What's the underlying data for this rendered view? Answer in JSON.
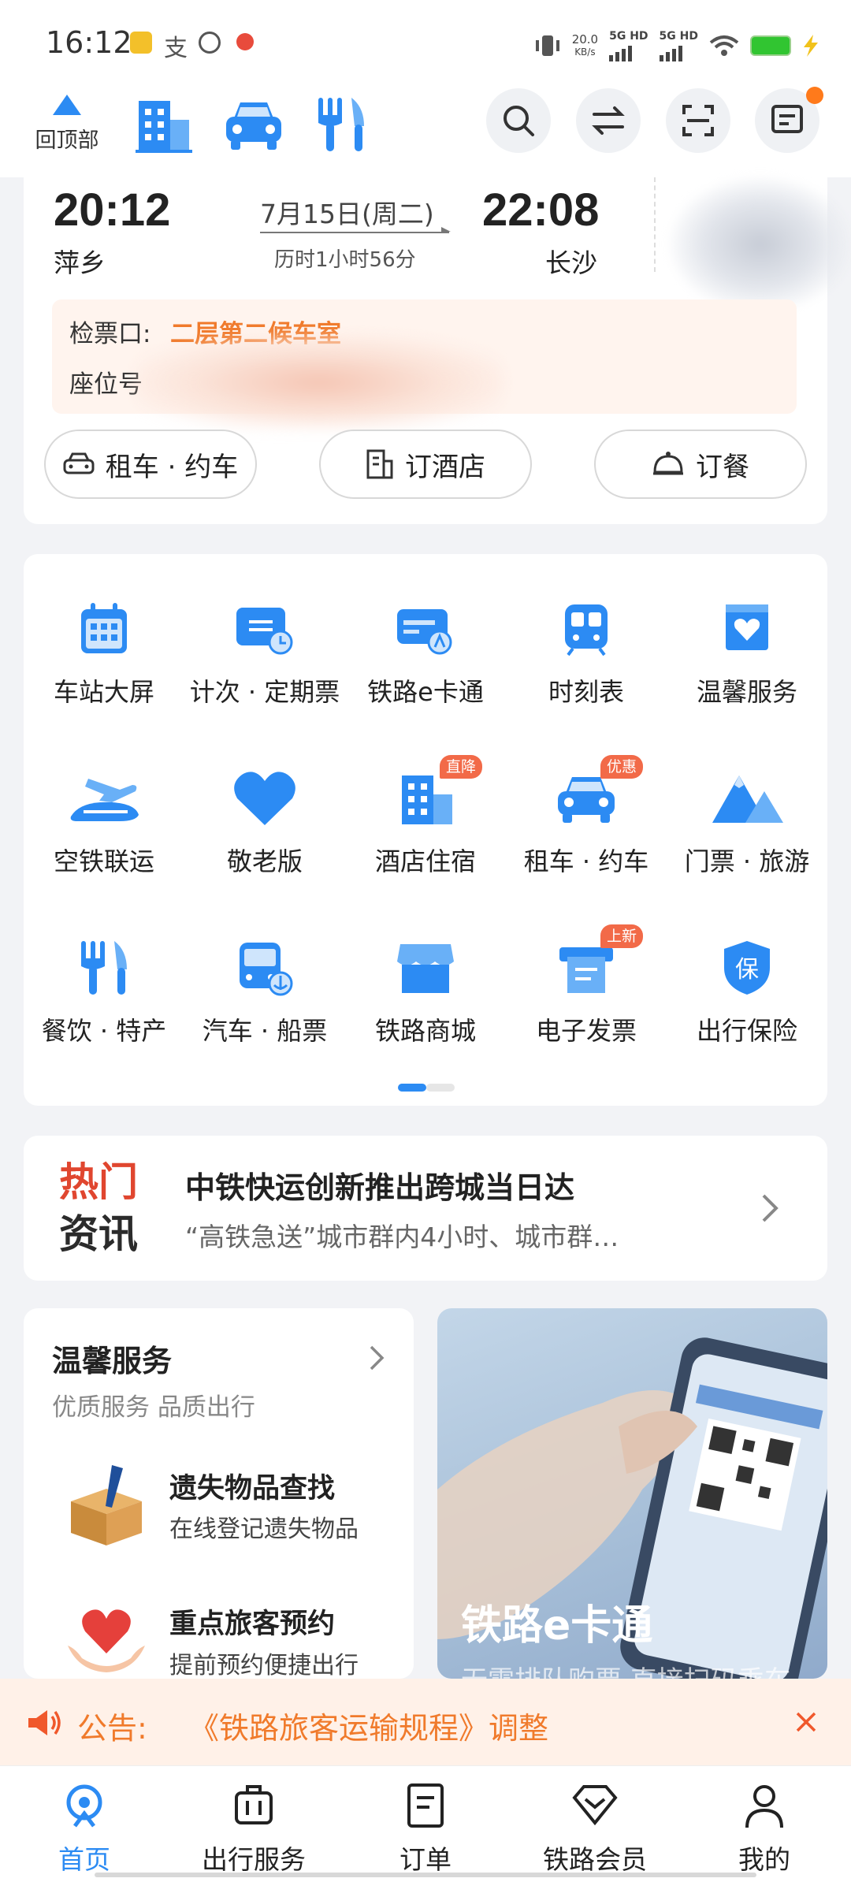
{
  "status_bar": {
    "time": "16:12",
    "speed_top": "20.0",
    "speed_unit": "KB/s",
    "net1": "5G HD",
    "net2": "5G HD"
  },
  "top_nav": {
    "back_top_label": "回顶部"
  },
  "trip": {
    "depart_time": "20:12",
    "depart_station": "萍乡",
    "date": "7月15日(周二)",
    "duration": "历时1小时56分",
    "arrive_time": "22:08",
    "arrive_station": "长沙",
    "gate_label": "检票口:",
    "gate_value": "二层第二候车室",
    "seat_label": "座位号",
    "actions": [
      "租车 · 约车",
      "订酒店",
      "订餐"
    ]
  },
  "grid": {
    "items": [
      {
        "label": "车站大屏",
        "icon": "calendar-icon",
        "badge": ""
      },
      {
        "label": "计次 · 定期票",
        "icon": "ticket-clock-icon",
        "badge": ""
      },
      {
        "label": "铁路e卡通",
        "icon": "rail-card-icon",
        "badge": ""
      },
      {
        "label": "时刻表",
        "icon": "train-icon",
        "badge": ""
      },
      {
        "label": "温馨服务",
        "icon": "heart-box-icon",
        "badge": ""
      },
      {
        "label": "空铁联运",
        "icon": "plane-train-icon",
        "badge": ""
      },
      {
        "label": "敬老版",
        "icon": "heart-icon",
        "badge": ""
      },
      {
        "label": "酒店住宿",
        "icon": "hotel-icon",
        "badge": "直降"
      },
      {
        "label": "租车 · 约车",
        "icon": "car-icon",
        "badge": "优惠"
      },
      {
        "label": "门票 · 旅游",
        "icon": "mountain-icon",
        "badge": ""
      },
      {
        "label": "餐饮 · 特产",
        "icon": "fork-knife-icon",
        "badge": ""
      },
      {
        "label": "汽车 · 船票",
        "icon": "bus-icon",
        "badge": ""
      },
      {
        "label": "铁路商城",
        "icon": "shop-icon",
        "badge": ""
      },
      {
        "label": "电子发票",
        "icon": "invoice-icon",
        "badge": "上新"
      },
      {
        "label": "出行保险",
        "icon": "shield-icon",
        "badge": ""
      }
    ]
  },
  "news": {
    "tag_line1": "热门",
    "tag_line2": "资讯",
    "title": "中铁快运创新推出跨城当日达",
    "subtitle": "“高铁急送”城市群内4小时、城市群…"
  },
  "service": {
    "title": "温馨服务",
    "subtitle": "优质服务 品质出行",
    "items": [
      {
        "title": "遗失物品查找",
        "sub": "在线登记遗失物品"
      },
      {
        "title": "重点旅客预约",
        "sub": "提前预约便捷出行"
      }
    ]
  },
  "promo": {
    "title": "铁路e卡通",
    "subtitle": "无需排队购票 直接扫码乘车"
  },
  "notice": {
    "label": "公告:",
    "text": "《铁路旅客运输规程》调整"
  },
  "tabs": [
    {
      "label": "首页",
      "active": true
    },
    {
      "label": "出行服务",
      "active": false
    },
    {
      "label": "订单",
      "active": false
    },
    {
      "label": "铁路会员",
      "active": false
    },
    {
      "label": "我的",
      "active": false
    }
  ],
  "colors": {
    "primary": "#2c8bf3",
    "accent": "#f07a2b",
    "badge": "#f26a48"
  }
}
